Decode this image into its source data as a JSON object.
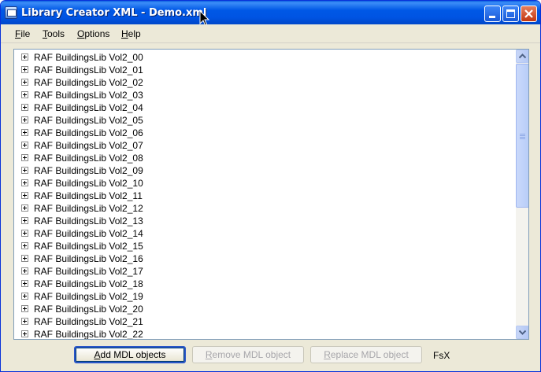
{
  "window": {
    "title": "Library Creator XML - Demo.xml"
  },
  "menu": {
    "items": [
      {
        "label": "File"
      },
      {
        "label": "Tools"
      },
      {
        "label": "Options"
      },
      {
        "label": "Help"
      }
    ]
  },
  "tree": {
    "items": [
      {
        "label": "RAF BuildingsLib Vol2_00"
      },
      {
        "label": "RAF BuildingsLib Vol2_01"
      },
      {
        "label": "RAF BuildingsLib Vol2_02"
      },
      {
        "label": "RAF BuildingsLib Vol2_03"
      },
      {
        "label": "RAF BuildingsLib Vol2_04"
      },
      {
        "label": "RAF BuildingsLib Vol2_05"
      },
      {
        "label": "RAF BuildingsLib Vol2_06"
      },
      {
        "label": "RAF BuildingsLib Vol2_07"
      },
      {
        "label": "RAF BuildingsLib Vol2_08"
      },
      {
        "label": "RAF BuildingsLib Vol2_09"
      },
      {
        "label": "RAF BuildingsLib Vol2_10"
      },
      {
        "label": "RAF BuildingsLib Vol2_11"
      },
      {
        "label": "RAF BuildingsLib Vol2_12"
      },
      {
        "label": "RAF BuildingsLib Vol2_13"
      },
      {
        "label": "RAF BuildingsLib Vol2_14"
      },
      {
        "label": "RAF BuildingsLib Vol2_15"
      },
      {
        "label": "RAF BuildingsLib Vol2_16"
      },
      {
        "label": "RAF BuildingsLib Vol2_17"
      },
      {
        "label": "RAF BuildingsLib Vol2_18"
      },
      {
        "label": "RAF BuildingsLib Vol2_19"
      },
      {
        "label": "RAF BuildingsLib Vol2_20"
      },
      {
        "label": "RAF BuildingsLib Vol2_21"
      },
      {
        "label": "RAF BuildingsLib Vol2_22"
      }
    ]
  },
  "buttons": {
    "add": "Add MDL objects",
    "remove": "Remove MDL object",
    "replace": "Replace MDL object"
  },
  "fsx_label": "FsX",
  "colors": {
    "titlebar": "#0054e3",
    "window_bg": "#ece9d8",
    "close_button": "#c2360f",
    "disabled_text": "#a7a6aa"
  }
}
